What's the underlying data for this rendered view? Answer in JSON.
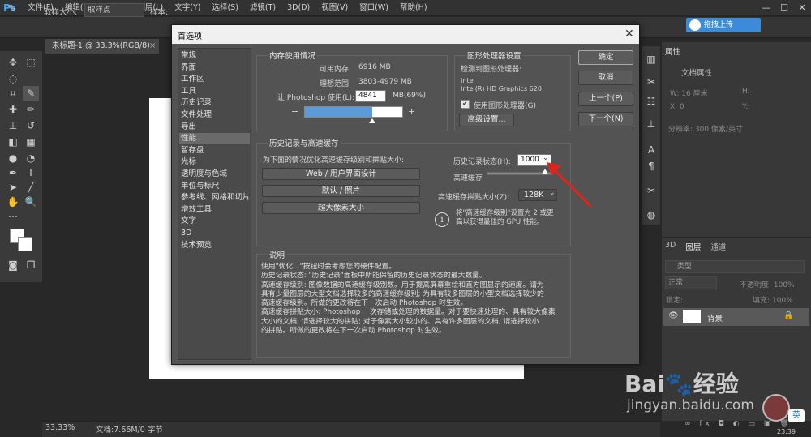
{
  "menubar": {
    "logo": "Ps",
    "items": [
      "文件(F)",
      "编辑(E)",
      "图像(I)",
      "图层(L)",
      "文字(Y)",
      "选择(S)",
      "滤镜(T)",
      "3D(D)",
      "视图(V)",
      "窗口(W)",
      "帮助(H)"
    ],
    "win_min": "—",
    "win_max": "☐",
    "win_close": "✕"
  },
  "options_bar": {
    "tool_icon": "eyedropper-icon",
    "sample_size_label": "取样大小:",
    "sample_size_value": "取样点",
    "sample_label": "样本:",
    "upload_button": "拖拽上传"
  },
  "document": {
    "tab_title": "未标题-1 @ 33.3%(RGB/8)",
    "tab_close": "×",
    "zoom": "33.33%",
    "doc_info": "文档:7.66M/0 字节"
  },
  "properties_panel": {
    "tab": "属性",
    "subtitle": "文档属性",
    "width_label": "W: 16 厘米",
    "height_label": "H:",
    "x_label": "X: 0",
    "y_label": "Y:",
    "resolution": "分辨率: 300 像素/英寸"
  },
  "layers_panel": {
    "tabs": [
      "3D",
      "图层",
      "通道"
    ],
    "filter_placeholder": "类型",
    "blend_mode": "正常",
    "opacity_label": "不透明度: 100%",
    "lock_label": "锁定:",
    "fill_label": "填充: 100%",
    "layer_name": "背景",
    "bottom_icons": "∞ fx ◘ ◐ ▭ ▣ 🗑"
  },
  "watermark": {
    "brand": "Bai🐾经验",
    "url": "jingyan.baidu.com"
  },
  "ime_badge": "英",
  "clock": "23:39",
  "dialog": {
    "title": "首选项",
    "close": "✕",
    "nav": {
      "items": [
        "常规",
        "界面",
        "工作区",
        "工具",
        "历史记录",
        "文件处理",
        "导出",
        "性能",
        "暂存盘",
        "光标",
        "透明度与色域",
        "单位与标尺",
        "参考线、网格和切片",
        "增效工具",
        "文字",
        "3D",
        "技术预览"
      ],
      "selected_index": 7
    },
    "memory": {
      "group_title": "内存使用情况",
      "available_label": "可用内存:",
      "available_value": "6916 MB",
      "ideal_label": "理想范围:",
      "ideal_value": "3803-4979 MB",
      "usage_label": "让 Photoshop 使用(L):",
      "usage_value": "4841",
      "usage_unit": "MB(69%)",
      "slider_fraction": 0.69,
      "minus": "−",
      "plus": "+"
    },
    "gpu": {
      "group_title": "图形处理器设置",
      "detected_label": "检测到图形处理器:",
      "vendor": "Intel",
      "model": "Intel(R) HD Graphics 620",
      "use_gpu_label": "使用图形处理器(G)",
      "use_gpu_checked": true,
      "advanced_button": "高级设置..."
    },
    "history_cache": {
      "group_title": "历史记录与高速缓存",
      "optimize_label": "为下面的情况优化高速缓存级别和拼贴大小:",
      "preset_buttons": [
        "Web / 用户界面设计",
        "默认 / 照片",
        "超大像素大小"
      ],
      "history_states_label": "历史记录状态(H):",
      "history_states_value": "1000",
      "cache_levels_label": "高速缓存",
      "cache_tile_label": "高速缓存拼贴大小(Z):",
      "cache_tile_value": "128K",
      "info_text_1": "将\"高速缓存级别\"设置为 2 或更",
      "info_text_2": "高以获得最佳的 GPU 性能。"
    },
    "description": {
      "group_title": "说明",
      "lines": [
        "使用\"优化...\"按钮时会考虑您的硬件配置。",
        "历史记录状态: \"历史记录\"面板中所能保留的历史记录状态的最大数量。",
        "高速缓存级别: 图像数据的高速缓存级别数。用于提高屏幕重绘和直方图显示的速度。请为",
        "具有少量图层的大型文档选择较多的高速缓存级别; 为具有较多图层的小型文档选择较少的",
        "高速缓存级别。所做的更改将在下一次启动 Photoshop 时生效。",
        "高速缓存拼贴大小: Photoshop 一次存储或处理的数据量。对于要快速处理的、具有较大像素",
        "大小的文档, 请选择较大的拼贴; 对于像素大小较小的、具有许多图层的文档, 请选择较小",
        "的拼贴。所做的更改将在下一次启动 Photoshop 时生效。"
      ]
    },
    "buttons": {
      "ok": "确定",
      "cancel": "取消",
      "prev": "上一个(P)",
      "next": "下一个(N)"
    }
  },
  "colors": {
    "accent_blue": "#5b9bd9",
    "annotation_red": "#e0241c",
    "ps_blue": "#31a8ff"
  }
}
